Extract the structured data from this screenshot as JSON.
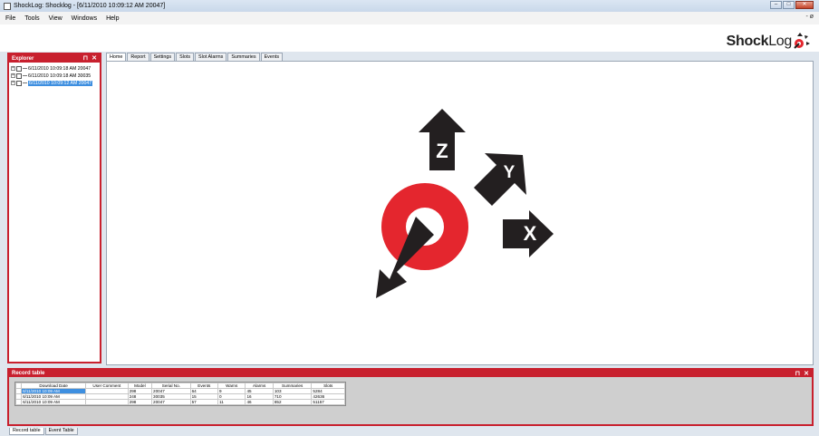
{
  "window": {
    "title": "ShockLog: Shocklog - [6/11/2010 10:09:12 AM  20047]",
    "min": "–",
    "max": "□",
    "close": "✕"
  },
  "menu": {
    "items": [
      "File",
      "Tools",
      "View",
      "Windows",
      "Help"
    ],
    "mdi_controls": "- ø"
  },
  "logo": {
    "text_bold": "Shock",
    "text_light": "Log"
  },
  "explorer": {
    "title": "Explorer",
    "pin": "⊓",
    "close": "✕",
    "items": [
      {
        "label": "6/11/2010 10:09:18 AM 20047"
      },
      {
        "label": "6/11/2010 10:09:18 AM 30035"
      },
      {
        "label": "6/11/2010 10:09:12 AM 20047"
      }
    ]
  },
  "tabs": [
    "Home",
    "Report",
    "Settings",
    "Slots",
    "Slot Alarms",
    "Summaries",
    "Events"
  ],
  "axes": {
    "z": "Z",
    "y": "Y",
    "x": "X",
    "accent": "#e4262e",
    "dark": "#231f20"
  },
  "record_table": {
    "title": "Record table",
    "pin": "⊓",
    "close": "✕",
    "columns": [
      "Download Date",
      "User Comment",
      "Model",
      "Serial No.",
      "Events",
      "Warns",
      "Alarms",
      "Summaries",
      "Slots"
    ],
    "rows": [
      [
        "6/11/2010 10:09 AM",
        "",
        "298",
        "20047",
        "64",
        "9",
        "45",
        "103",
        "5284"
      ],
      [
        "6/11/2010 10:09 AM",
        "",
        "248",
        "30035",
        "15",
        "0",
        "16",
        "710",
        "42636"
      ],
      [
        "6/11/2010 10:09 AM",
        "",
        "298",
        "20047",
        "57",
        "11",
        "46",
        "852",
        "51157"
      ]
    ]
  },
  "bottom_tabs": [
    "Record table",
    "Event Table"
  ]
}
